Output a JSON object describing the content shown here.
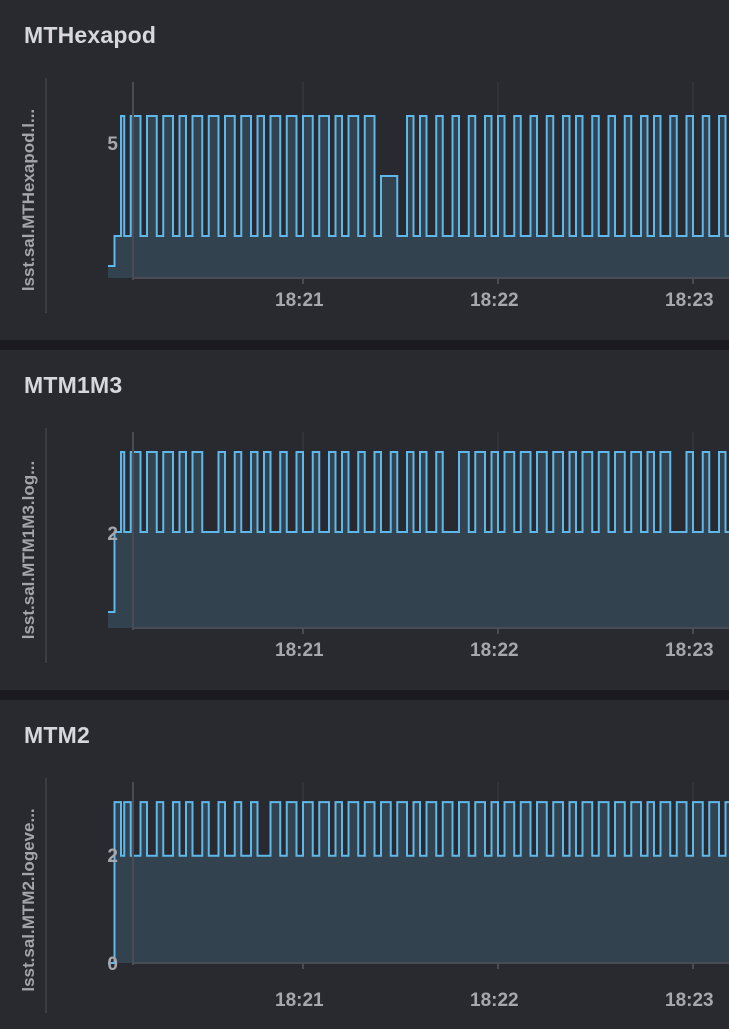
{
  "panels": [
    {
      "title": "MTHexapod",
      "ylabel": "lsst.sal.MTHexapod.l..."
    },
    {
      "title": "MTM1M3",
      "ylabel": "lsst.sal.MTM1M3.log..."
    },
    {
      "title": "MTM2",
      "ylabel": "lsst.sal.MTM2.logeve..."
    }
  ],
  "colors": {
    "background": "#1a1a20",
    "panel": "#292930",
    "line": "#5fb8ea",
    "fill": "#33424f",
    "grid": "#3a3b44",
    "axis": "#4a4c55",
    "text": "#d8d8dc"
  },
  "chart_data": [
    {
      "type": "line",
      "title": "MTHexapod",
      "ylabel": "lsst.sal.MTHexapod.l...",
      "x_ticks": [
        "18:21",
        "18:22",
        "18:23"
      ],
      "y_ticks": [
        "5"
      ],
      "ylim": [
        3.3,
        6.5
      ],
      "grid": true,
      "series": [
        {
          "step": "after",
          "x": [
            "18:20:00",
            "18:20:02",
            "18:20:04",
            "18:20:05",
            "18:20:07",
            "18:20:10",
            "18:20:12",
            "18:20:15",
            "18:20:17",
            "18:20:20",
            "18:20:22",
            "18:20:24",
            "18:20:26",
            "18:20:29",
            "18:20:31",
            "18:20:34",
            "18:20:36",
            "18:20:39",
            "18:20:41",
            "18:20:44",
            "18:20:46",
            "18:20:48",
            "18:20:50",
            "18:20:53",
            "18:20:55",
            "18:20:58",
            "18:21:00",
            "18:21:03",
            "18:21:05",
            "18:21:08",
            "18:21:10",
            "18:21:12",
            "18:21:14",
            "18:21:17",
            "18:21:19",
            "18:21:22",
            "18:21:24",
            "18:21:27",
            "18:21:29",
            "18:21:32",
            "18:21:34",
            "18:21:36",
            "18:21:38",
            "18:21:41",
            "18:21:43",
            "18:21:46",
            "18:21:48",
            "18:21:51",
            "18:21:53",
            "18:21:56",
            "18:21:58",
            "18:22:00",
            "18:22:02",
            "18:22:05",
            "18:22:07",
            "18:22:10",
            "18:22:12",
            "18:22:15",
            "18:22:17",
            "18:22:20",
            "18:22:22",
            "18:22:24",
            "18:22:26",
            "18:22:29",
            "18:22:31",
            "18:22:34",
            "18:22:36",
            "18:22:39",
            "18:22:41",
            "18:22:44",
            "18:22:46",
            "18:22:48",
            "18:22:50",
            "18:22:53",
            "18:22:55",
            "18:22:58",
            "18:23:00",
            "18:23:03",
            "18:23:05",
            "18:23:08",
            "18:23:10",
            "18:23:12",
            "18:23:14",
            "18:23:17",
            "18:23:19"
          ],
          "y": [
            3.5,
            4,
            6,
            4,
            6,
            4,
            6,
            4,
            6,
            4,
            6,
            4,
            6,
            4,
            6,
            4,
            6,
            4,
            6,
            4,
            6,
            4,
            6,
            4,
            6,
            4,
            6,
            4,
            6,
            4,
            6,
            4,
            6,
            4,
            6,
            4,
            5,
            5,
            4,
            6,
            4,
            6,
            4,
            6,
            4,
            6,
            4,
            6,
            4,
            6,
            4,
            6,
            4,
            6,
            4,
            6,
            4,
            6,
            4,
            6,
            4,
            6,
            4,
            6,
            4,
            6,
            4,
            6,
            4,
            6,
            4,
            6,
            4,
            6,
            4,
            6,
            4,
            6,
            4,
            6,
            4,
            6,
            4,
            6,
            4
          ]
        }
      ]
    },
    {
      "type": "line",
      "title": "MTM1M3",
      "ylabel": "lsst.sal.MTM1M3.log...",
      "x_ticks": [
        "18:21",
        "18:22",
        "18:23"
      ],
      "y_ticks": [
        "2"
      ],
      "ylim": [
        0.8,
        3.2
      ],
      "grid": true,
      "series": [
        {
          "step": "after",
          "x": [
            "18:20:00",
            "18:20:02",
            "18:20:04",
            "18:20:05",
            "18:20:07",
            "18:20:10",
            "18:20:12",
            "18:20:15",
            "18:20:17",
            "18:20:20",
            "18:20:22",
            "18:20:24",
            "18:20:26",
            "18:20:29",
            "18:20:31",
            "18:20:34",
            "18:20:36",
            "18:20:39",
            "18:20:41",
            "18:20:44",
            "18:20:46",
            "18:20:48",
            "18:20:50",
            "18:20:53",
            "18:20:55",
            "18:20:58",
            "18:21:00",
            "18:21:03",
            "18:21:05",
            "18:21:08",
            "18:21:10",
            "18:21:12",
            "18:21:14",
            "18:21:17",
            "18:21:19",
            "18:21:22",
            "18:21:24",
            "18:21:27",
            "18:21:29",
            "18:21:32",
            "18:21:34",
            "18:21:36",
            "18:21:38",
            "18:21:41",
            "18:21:43",
            "18:21:46",
            "18:21:48",
            "18:21:51",
            "18:21:53",
            "18:21:56",
            "18:21:58",
            "18:22:00",
            "18:22:02",
            "18:22:05",
            "18:22:07",
            "18:22:10",
            "18:22:12",
            "18:22:15",
            "18:22:17",
            "18:22:20",
            "18:22:22",
            "18:22:24",
            "18:22:26",
            "18:22:29",
            "18:22:31",
            "18:22:34",
            "18:22:36",
            "18:22:39",
            "18:22:41",
            "18:22:44",
            "18:22:46",
            "18:22:48",
            "18:22:50",
            "18:22:53",
            "18:22:55",
            "18:22:58",
            "18:23:00",
            "18:23:03",
            "18:23:05",
            "18:23:08",
            "18:23:10",
            "18:23:12",
            "18:23:14",
            "18:23:17",
            "18:23:19"
          ],
          "y": [
            1,
            2,
            3,
            2,
            3,
            2,
            3,
            2,
            3,
            2,
            3,
            2,
            3,
            2,
            2,
            3,
            2,
            3,
            2,
            3,
            2,
            3,
            2,
            3,
            2,
            3,
            2,
            3,
            2,
            3,
            2,
            3,
            2,
            3,
            2,
            3,
            2,
            3,
            2,
            3,
            2,
            3,
            2,
            3,
            2,
            2,
            3,
            2,
            3,
            2,
            3,
            2,
            3,
            2,
            3,
            2,
            3,
            2,
            3,
            2,
            3,
            2,
            3,
            2,
            3,
            2,
            3,
            2,
            3,
            2,
            3,
            2,
            3,
            2,
            2,
            3,
            2,
            3,
            2,
            3,
            2,
            3,
            2,
            3,
            2
          ]
        }
      ]
    },
    {
      "type": "line",
      "title": "MTM2",
      "ylabel": "lsst.sal.MTM2.logeve...",
      "x_ticks": [
        "18:21",
        "18:22",
        "18:23"
      ],
      "y_ticks": [
        "2",
        "0"
      ],
      "ylim": [
        0,
        3.3
      ],
      "grid": true,
      "series": [
        {
          "step": "after",
          "x": [
            "18:20:00",
            "18:20:02",
            "18:20:04",
            "18:20:05",
            "18:20:07",
            "18:20:10",
            "18:20:12",
            "18:20:15",
            "18:20:17",
            "18:20:20",
            "18:20:22",
            "18:20:24",
            "18:20:26",
            "18:20:29",
            "18:20:31",
            "18:20:34",
            "18:20:36",
            "18:20:39",
            "18:20:41",
            "18:20:44",
            "18:20:46",
            "18:20:48",
            "18:20:50",
            "18:20:53",
            "18:20:55",
            "18:20:58",
            "18:21:00",
            "18:21:03",
            "18:21:05",
            "18:21:08",
            "18:21:10",
            "18:21:12",
            "18:21:14",
            "18:21:17",
            "18:21:19",
            "18:21:22",
            "18:21:24",
            "18:21:27",
            "18:21:29",
            "18:21:32",
            "18:21:34",
            "18:21:36",
            "18:21:38",
            "18:21:41",
            "18:21:43",
            "18:21:46",
            "18:21:48",
            "18:21:51",
            "18:21:53",
            "18:21:56",
            "18:21:58",
            "18:22:00",
            "18:22:02",
            "18:22:05",
            "18:22:07",
            "18:22:10",
            "18:22:12",
            "18:22:15",
            "18:22:17",
            "18:22:20",
            "18:22:22",
            "18:22:24",
            "18:22:26",
            "18:22:29",
            "18:22:31",
            "18:22:34",
            "18:22:36",
            "18:22:39",
            "18:22:41",
            "18:22:44",
            "18:22:46",
            "18:22:48",
            "18:22:50",
            "18:22:53",
            "18:22:55",
            "18:22:58",
            "18:23:00",
            "18:23:03",
            "18:23:05",
            "18:23:08",
            "18:23:10",
            "18:23:12",
            "18:23:14",
            "18:23:17",
            "18:23:19"
          ],
          "y": [
            0,
            3,
            2,
            3,
            2,
            3,
            2,
            3,
            2,
            3,
            2,
            3,
            2,
            3,
            2,
            3,
            2,
            3,
            2,
            3,
            2,
            2,
            3,
            2,
            3,
            2,
            3,
            2,
            3,
            2,
            3,
            2,
            3,
            2,
            3,
            2,
            3,
            2,
            3,
            2,
            3,
            2,
            3,
            2,
            3,
            2,
            3,
            2,
            3,
            2,
            3,
            2,
            3,
            2,
            3,
            2,
            3,
            2,
            3,
            2,
            3,
            2,
            3,
            2,
            3,
            2,
            3,
            2,
            3,
            2,
            3,
            2,
            3,
            2,
            3,
            2,
            3,
            2,
            3,
            2,
            3,
            2,
            3,
            2,
            3
          ]
        }
      ]
    }
  ]
}
